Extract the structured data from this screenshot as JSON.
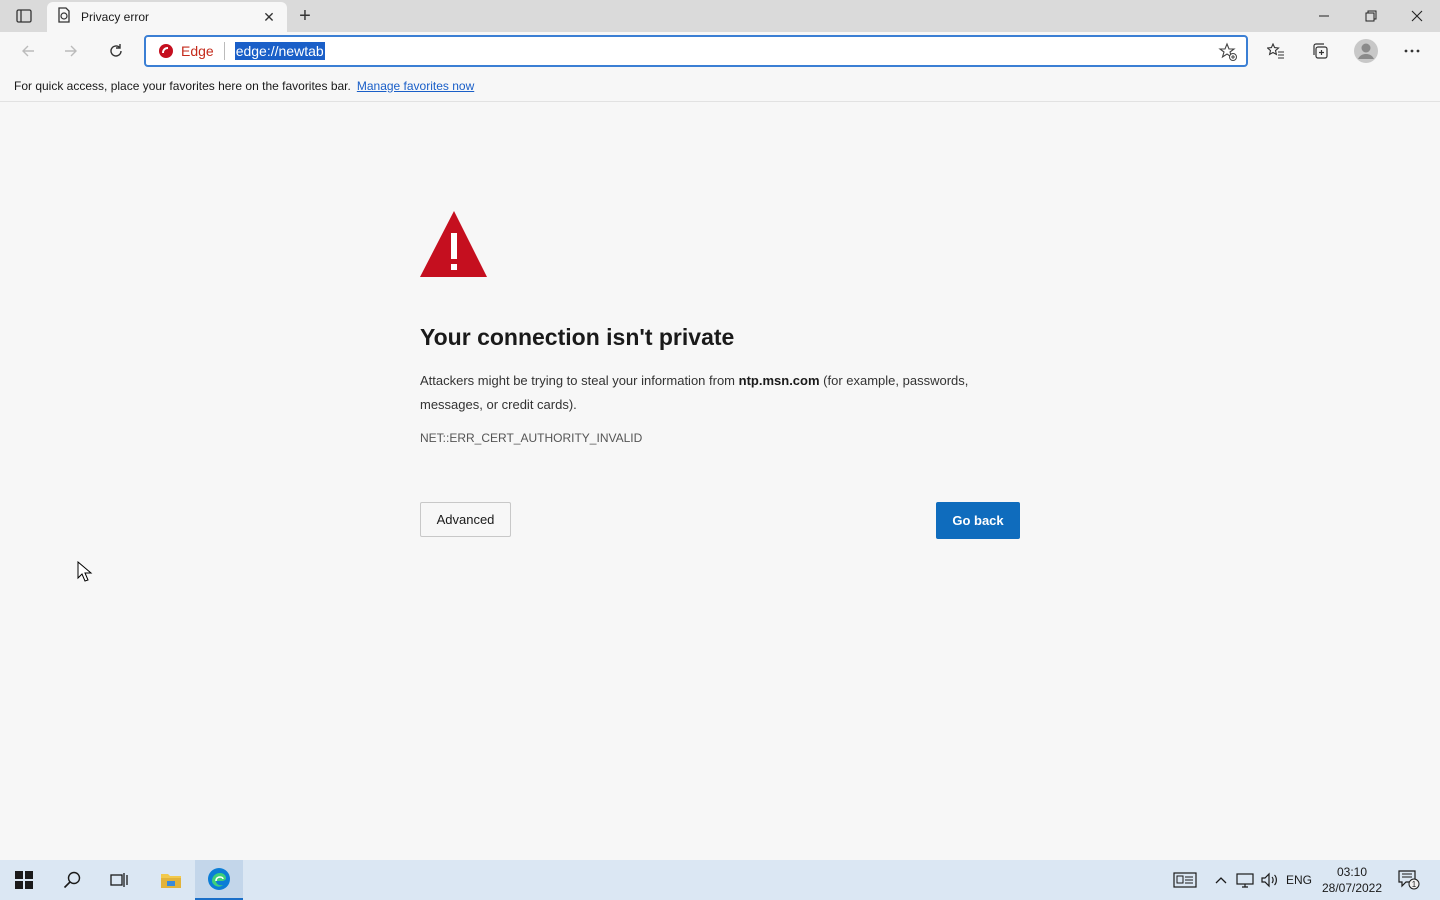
{
  "window": {
    "tab_title": "Privacy error",
    "tab_close_icon": "close-icon",
    "new_tab_icon": "plus-icon",
    "controls": [
      "minimize-icon",
      "restore-icon",
      "close-icon"
    ]
  },
  "toolbar": {
    "site_label": "Edge",
    "url": "edge://newtab",
    "icons": [
      "back-icon",
      "forward-icon",
      "refresh-icon",
      "add-favorite-icon",
      "favorites-icon",
      "collections-icon",
      "profile-icon",
      "more-icon"
    ]
  },
  "favorites_bar": {
    "message": "For quick access, place your favorites here on the favorites bar.",
    "link": "Manage favorites now"
  },
  "error_page": {
    "heading": "Your connection isn't private",
    "desc_before": "Attackers might be trying to steal your information from ",
    "host": "ntp.msn.com",
    "desc_after": " (for example, passwords, messages, or credit cards).",
    "error_code": "NET::ERR_CERT_AUTHORITY_INVALID",
    "advanced_label": "Advanced",
    "go_back_label": "Go back",
    "warning_color": "#c50f1f",
    "accent_color": "#0f6cbd"
  },
  "taskbar": {
    "items": [
      "start-icon",
      "search-icon",
      "task-view-icon",
      "file-explorer-icon",
      "edge-icon"
    ],
    "language": "ENG",
    "time": "03:10",
    "date": "28/07/2022",
    "notification_count": "1"
  }
}
